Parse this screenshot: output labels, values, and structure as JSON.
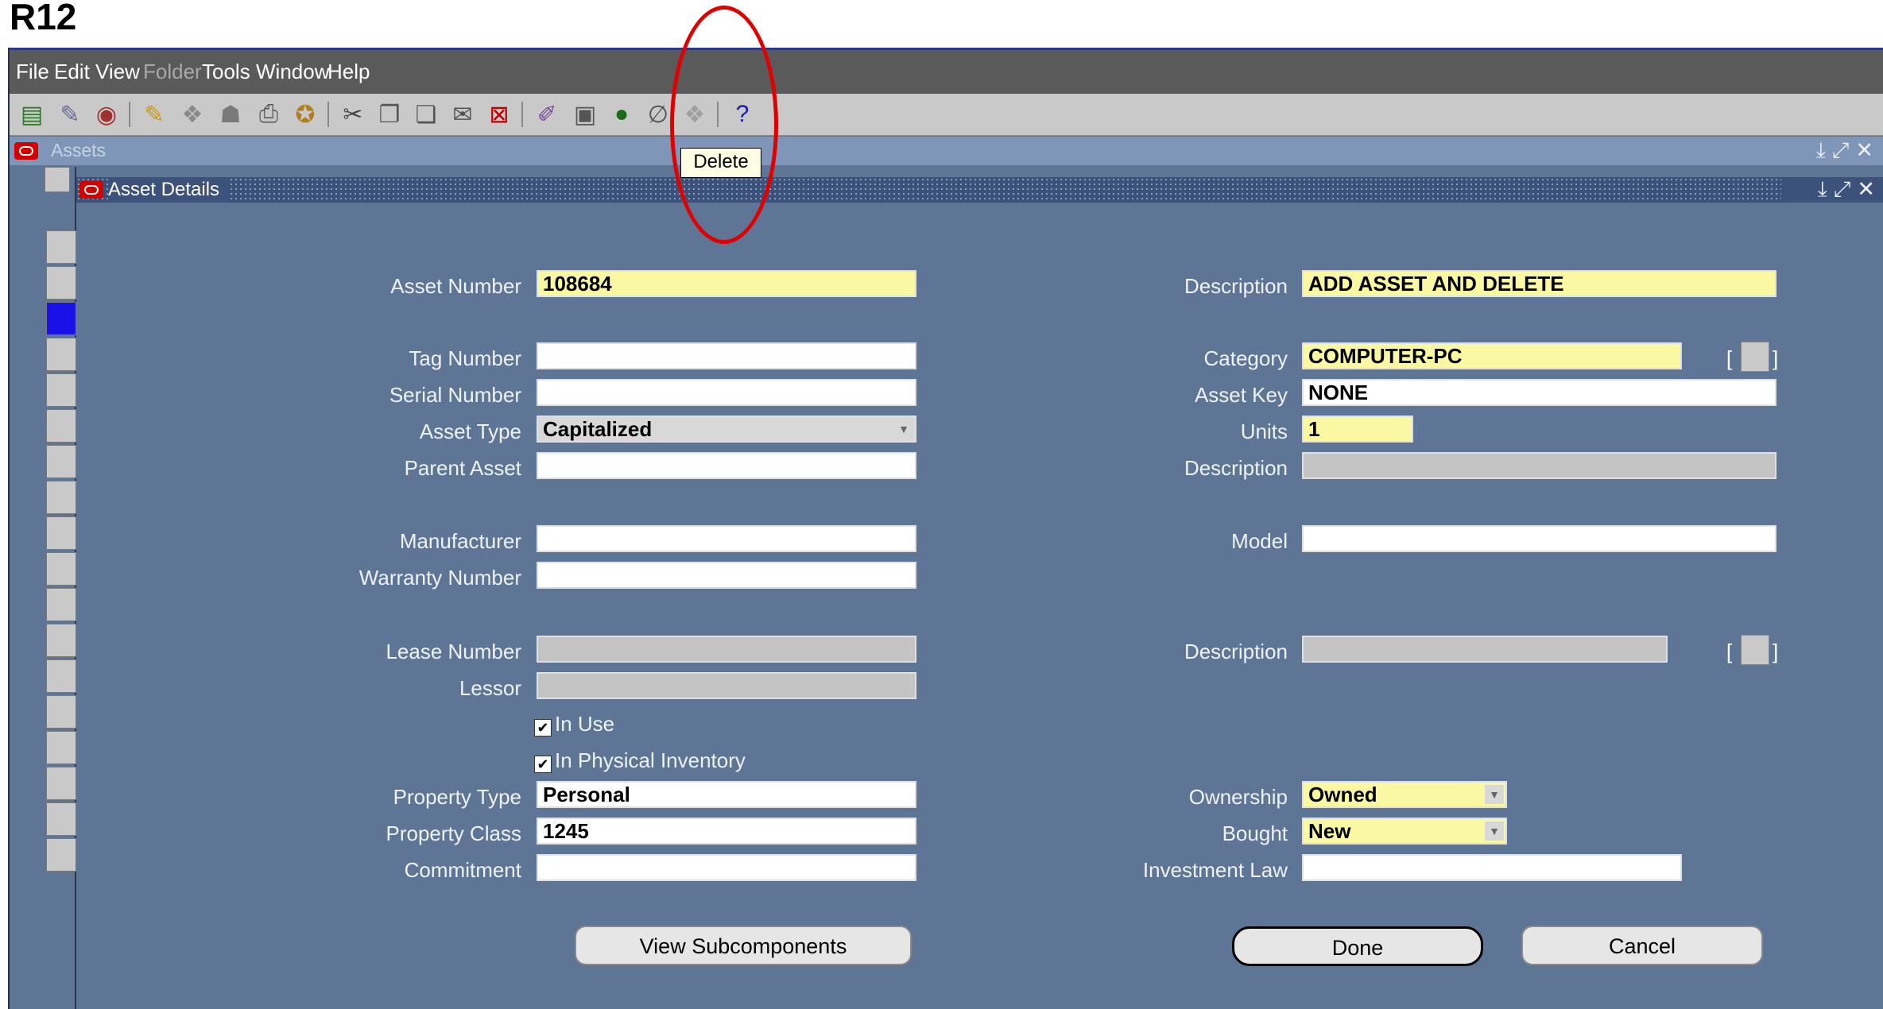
{
  "slide": {
    "title": "R12"
  },
  "menu": [
    "File",
    "Edit",
    "View",
    "Folder",
    "Tools",
    "Window",
    "Help"
  ],
  "toolbar": {
    "tooltip": "Delete",
    "help_glyph": "?"
  },
  "windows": {
    "assets_title": "Assets",
    "dialog_title": "Asset Details"
  },
  "form": {
    "left": {
      "asset_number": {
        "label": "Asset Number",
        "value": "108684"
      },
      "tag_number": {
        "label": "Tag Number",
        "value": ""
      },
      "serial_number": {
        "label": "Serial Number",
        "value": ""
      },
      "asset_type": {
        "label": "Asset Type",
        "value": "Capitalized"
      },
      "parent_asset": {
        "label": "Parent Asset",
        "value": ""
      },
      "manufacturer": {
        "label": "Manufacturer",
        "value": ""
      },
      "warranty_number": {
        "label": "Warranty Number",
        "value": ""
      },
      "lease_number": {
        "label": "Lease Number",
        "value": ""
      },
      "lessor": {
        "label": "Lessor",
        "value": ""
      },
      "in_use": {
        "label": "In Use",
        "checked": true
      },
      "in_physical_inventory": {
        "label": "In Physical Inventory",
        "checked": true
      },
      "property_type": {
        "label": "Property Type",
        "value": "Personal"
      },
      "property_class": {
        "label": "Property Class",
        "value": "1245"
      },
      "commitment": {
        "label": "Commitment",
        "value": ""
      }
    },
    "right": {
      "description": {
        "label": "Description",
        "value": "ADD ASSET AND DELETE"
      },
      "category": {
        "label": "Category",
        "value": "COMPUTER-PC"
      },
      "asset_key": {
        "label": "Asset Key",
        "value": "NONE"
      },
      "units": {
        "label": "Units",
        "value": "1"
      },
      "category_description": {
        "label": "Description",
        "value": ""
      },
      "model": {
        "label": "Model",
        "value": ""
      },
      "lease_description": {
        "label": "Description",
        "value": ""
      },
      "ownership": {
        "label": "Ownership",
        "value": "Owned"
      },
      "bought": {
        "label": "Bought",
        "value": "New"
      },
      "investment_law": {
        "label": "Investment Law",
        "value": ""
      }
    }
  },
  "buttons": {
    "view_subcomponents": "View Subcomponents",
    "done": "Done",
    "cancel": "Cancel"
  },
  "colors": {
    "form_bg": "#5f7596",
    "required_field": "#fbf8a4",
    "highlight_circle": "#e00000"
  }
}
